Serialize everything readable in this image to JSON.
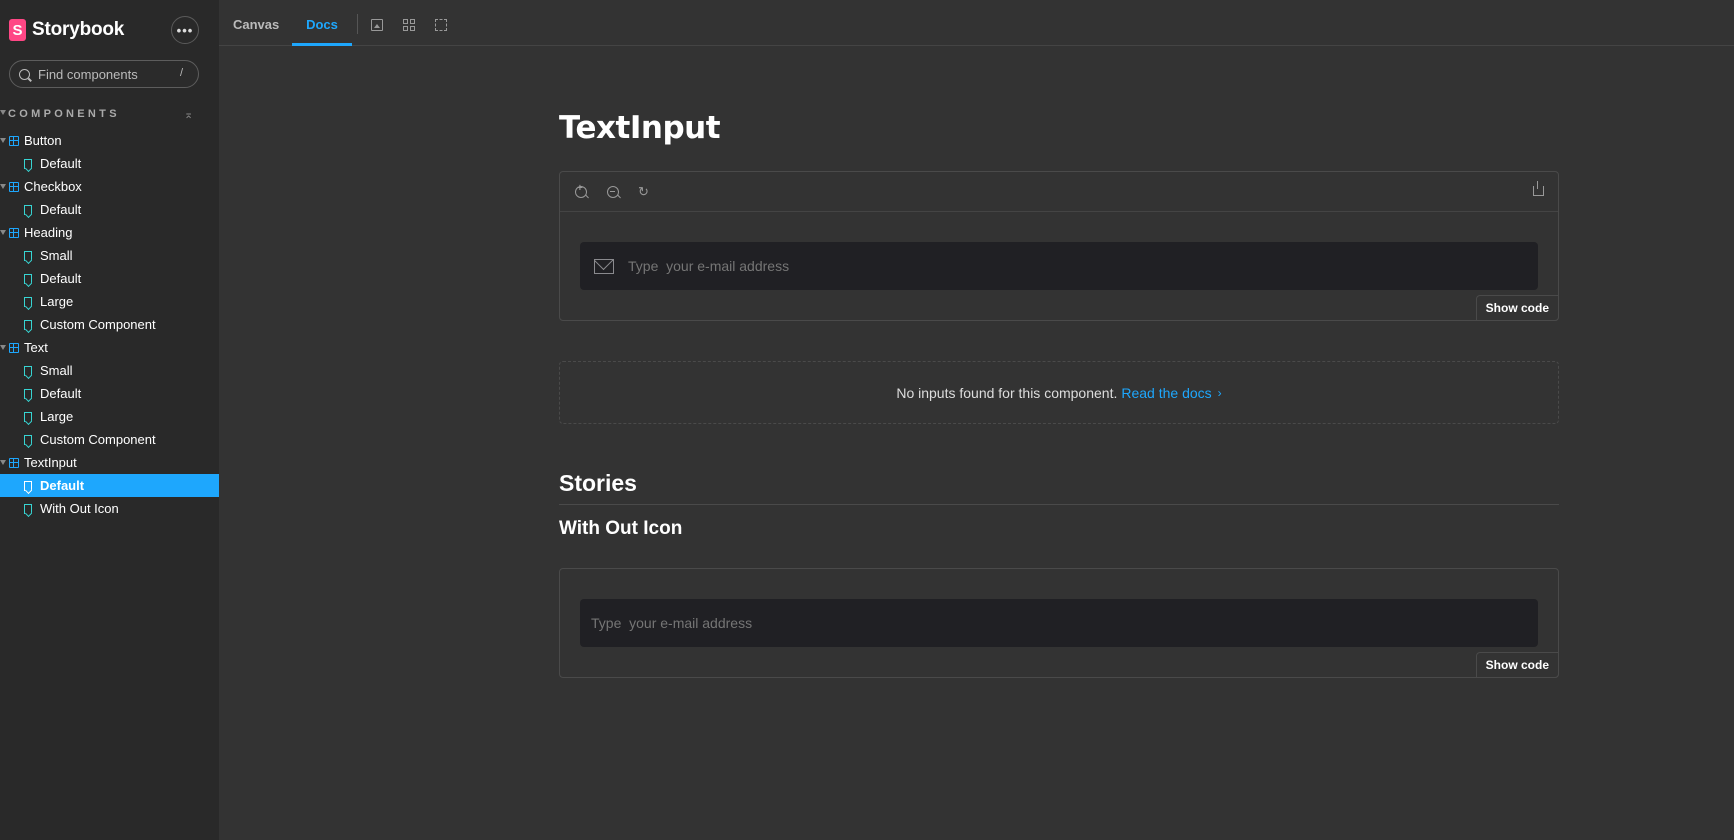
{
  "sidebar": {
    "brand": {
      "logo_letter": "S",
      "name": "Storybook"
    },
    "more_label": "•••",
    "search": {
      "placeholder": "Find components",
      "shortcut": "/"
    },
    "section_title": "COMPONENTS",
    "collapse_glyph": "⌅",
    "tree": [
      {
        "type": "component",
        "label": "Button"
      },
      {
        "type": "story",
        "label": "Default"
      },
      {
        "type": "component",
        "label": "Checkbox"
      },
      {
        "type": "story",
        "label": "Default"
      },
      {
        "type": "component",
        "label": "Heading"
      },
      {
        "type": "story",
        "label": "Small"
      },
      {
        "type": "story",
        "label": "Default"
      },
      {
        "type": "story",
        "label": "Large"
      },
      {
        "type": "story",
        "label": "Custom Component"
      },
      {
        "type": "component",
        "label": "Text"
      },
      {
        "type": "story",
        "label": "Small"
      },
      {
        "type": "story",
        "label": "Default"
      },
      {
        "type": "story",
        "label": "Large"
      },
      {
        "type": "story",
        "label": "Custom Component"
      },
      {
        "type": "component",
        "label": "TextInput"
      },
      {
        "type": "story",
        "label": "Default",
        "selected": true
      },
      {
        "type": "story",
        "label": "With Out Icon"
      }
    ]
  },
  "toolbar": {
    "tabs": [
      {
        "label": "Canvas",
        "active": false
      },
      {
        "label": "Docs",
        "active": true
      }
    ],
    "icons": [
      "image-icon",
      "grid-icon",
      "outline-icon"
    ]
  },
  "docs": {
    "title": "TextInput",
    "primary_preview": {
      "placeholder": "Type  your e-mail address",
      "show_code_label": "Show code",
      "tool_icons": [
        "zoom-in-icon",
        "zoom-out-icon",
        "reset-zoom-icon",
        "share-icon"
      ]
    },
    "args": {
      "message": "No inputs found for this component.",
      "link_label": "Read the docs",
      "chevron": "›"
    },
    "stories_heading": "Stories",
    "stories": [
      {
        "title": "With Out Icon",
        "placeholder": "Type  your e-mail address",
        "show_code_label": "Show code"
      }
    ]
  },
  "colors": {
    "accent": "#1ea7fd",
    "brand": "#ff4785",
    "story_icon": "#37d5d3",
    "background": "#333333",
    "sidebar_background": "#292929"
  }
}
